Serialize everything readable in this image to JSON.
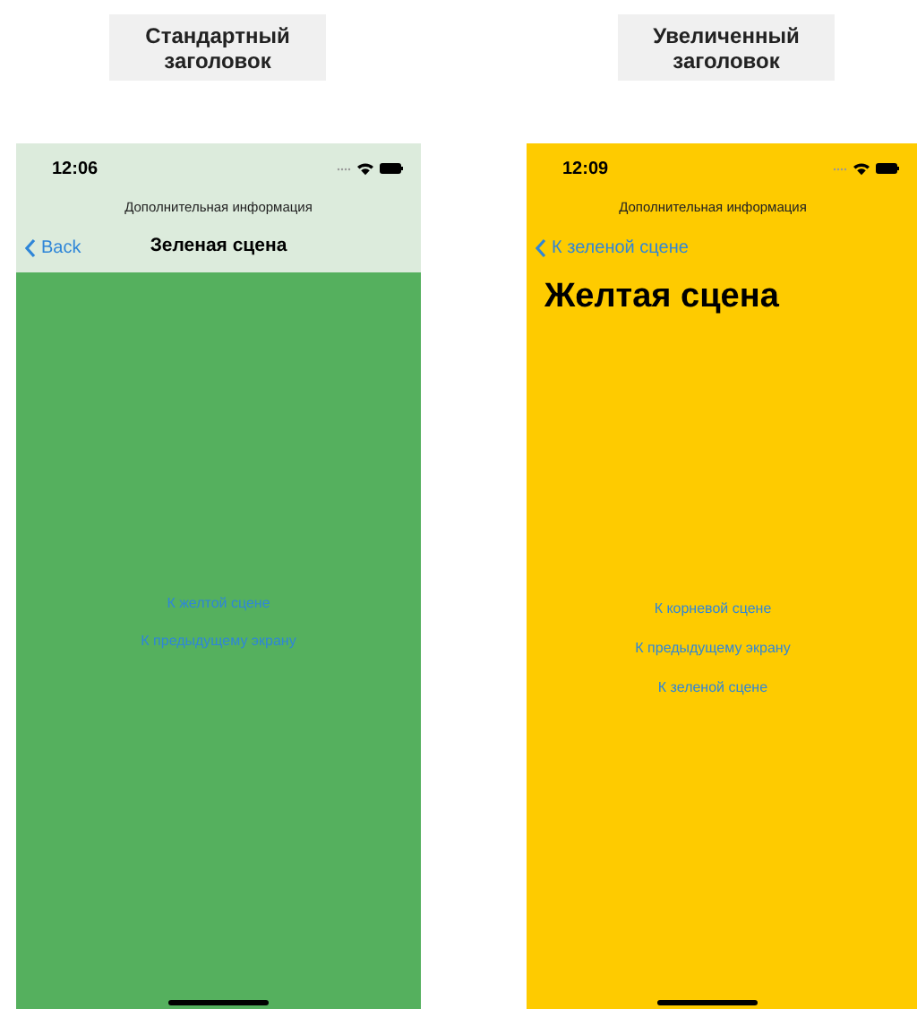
{
  "screens": [
    {
      "caption": "Стандартный заголовок",
      "kind": "standard",
      "time": "12:06",
      "prompt": "Дополнительная информация",
      "back": "Back",
      "title": "Зеленая сцена",
      "links": [
        "К желтой сцене",
        "К предыдущему экрану"
      ]
    },
    {
      "caption": "Увеличенный заголовок",
      "kind": "large",
      "time": "12:09",
      "prompt": "Дополнительная информация",
      "back": "К зеленой сцене",
      "title": "Желтая сцена",
      "links": [
        "К корневой сцене",
        "К предыдущему экрану",
        "К зеленой сцене"
      ]
    }
  ]
}
